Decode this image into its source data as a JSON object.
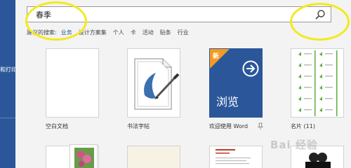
{
  "sidebar": {
    "label": "和打印"
  },
  "search": {
    "value": "春季"
  },
  "suggestions": {
    "label": "建议的搜索:",
    "items": [
      "业务",
      "设计方案集",
      "个人",
      "卡",
      "活动",
      "贴条",
      "行业"
    ]
  },
  "templates": [
    {
      "label": "空白文档"
    },
    {
      "label": "书法字帖"
    },
    {
      "label": "欢迎使用 Word",
      "badge": "新",
      "tile_text": "浏览"
    },
    {
      "label": "名片 (11)"
    }
  ],
  "watermark": "Bai 经验",
  "colors": {
    "sidebar": "#2b579a",
    "highlight": "#f2ea1c",
    "word_tile": "#2b579a",
    "badge": "#f39b21",
    "leaf_green": "#5fae3c"
  }
}
